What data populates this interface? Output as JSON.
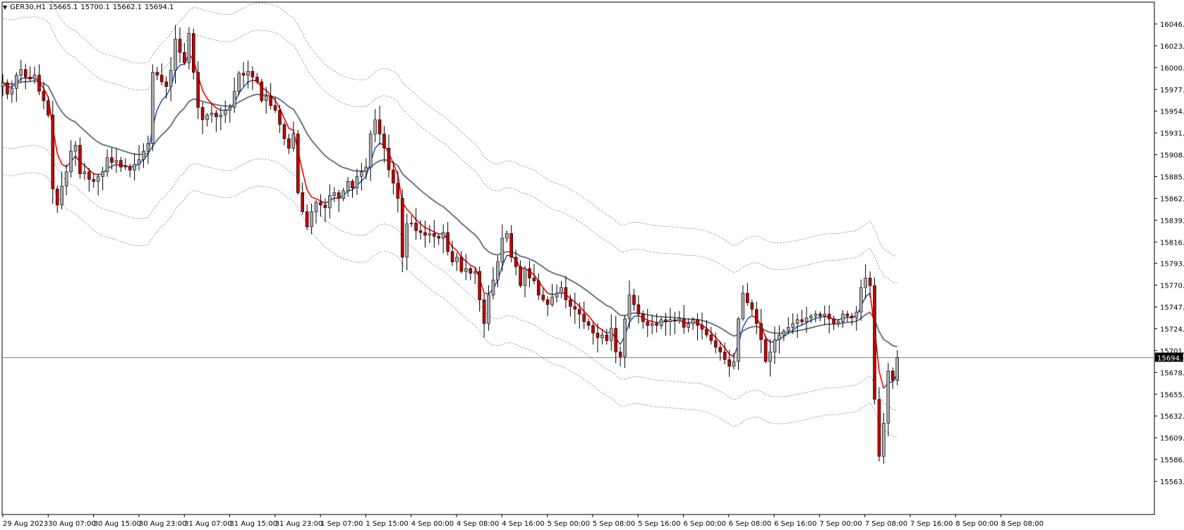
{
  "header": {
    "symbol": "GER30,H1",
    "open": "15665.1",
    "high": "15700.1",
    "low": "15662.1",
    "close": "15694.1"
  },
  "colors": {
    "bull_body": "#a9a9a9",
    "bear_body": "#c00000",
    "wick": "#000000",
    "ma_fast_down": "#ff0000",
    "ma_fast_up": "#2e5bb8",
    "ma_slow": "#6b7a8a",
    "envelope": "#808080",
    "price_line": "#808080"
  },
  "chart_data": {
    "type": "candlestick",
    "ylim": [
      15563.5,
      16060
    ],
    "y_ticks": [
      "16046.0",
      "16023.0",
      "16000.0",
      "15977.0",
      "15954.0",
      "15931.0",
      "15908.0",
      "15885.0",
      "15862.0",
      "15839.0",
      "15816.0",
      "15793.5",
      "15770.5",
      "15747.5",
      "15724.5",
      "15701.5",
      "15678.5",
      "15655.5",
      "15632.5",
      "15609.5",
      "15586.5",
      "15563.5"
    ],
    "current_price": "15694.1",
    "x_labels": [
      "29 Aug 2023",
      "30 Aug 07:00",
      "30 Aug 15:00",
      "30 Aug 23:00",
      "31 Aug 07:00",
      "31 Aug 15:00",
      "31 Aug 23:00",
      "1 Sep 07:00",
      "1 Sep 15:00",
      "4 Sep 00:00",
      "4 Sep 08:00",
      "4 Sep 16:00",
      "5 Sep 00:00",
      "5 Sep 08:00",
      "5 Sep 16:00",
      "6 Sep 00:00",
      "6 Sep 08:00",
      "6 Sep 16:00",
      "7 Sep 00:00",
      "7 Sep 08:00",
      "7 Sep 16:00",
      "8 Sep 00:00",
      "8 Sep 08:00"
    ],
    "closes": [
      15984,
      15972,
      15978,
      15992,
      15998,
      15990,
      15988,
      15992,
      15975,
      15965,
      15950,
      15872,
      15855,
      15875,
      15890,
      15912,
      15918,
      15888,
      15890,
      15882,
      15880,
      15885,
      15890,
      15905,
      15900,
      15902,
      15895,
      15896,
      15892,
      15898,
      15903,
      15912,
      15920,
      15995,
      15992,
      15985,
      15980,
      15997,
      16030,
      16016,
      16005,
      16036,
      15995,
      15958,
      15945,
      15950,
      15952,
      15948,
      15950,
      15955,
      15958,
      15975,
      15994,
      15992,
      15996,
      15990,
      15985,
      15965,
      15970,
      15960,
      15955,
      15940,
      15925,
      15915,
      15930,
      15868,
      15848,
      15832,
      15848,
      15858,
      15855,
      15852,
      15865,
      15868,
      15862,
      15870,
      15880,
      15873,
      15885,
      15890,
      15895,
      15930,
      15945,
      15930,
      15915,
      15892,
      15878,
      15862,
      15800,
      15835,
      15836,
      15828,
      15826,
      15823,
      15825,
      15822,
      15820,
      15826,
      15806,
      15795,
      15800,
      15785,
      15788,
      15783,
      15785,
      15755,
      15730,
      15760,
      15776,
      15795,
      15820,
      15825,
      15800,
      15790,
      15770,
      15788,
      15778,
      15775,
      15760,
      15755,
      15750,
      15758,
      15762,
      15768,
      15755,
      15748,
      15745,
      15740,
      15732,
      15728,
      15720,
      15715,
      15718,
      15712,
      15725,
      15700,
      15695,
      15735,
      15760,
      15750,
      15740,
      15732,
      15728,
      15730,
      15728,
      15734,
      15732,
      15734,
      15733,
      15735,
      15726,
      15730,
      15734,
      15728,
      15724,
      15718,
      15712,
      15705,
      15700,
      15692,
      15685,
      15690,
      15735,
      15762,
      15752,
      15745,
      15730,
      15713,
      15690,
      15700,
      15713,
      15718,
      15722,
      15726,
      15730,
      15734,
      15732,
      15736,
      15738,
      15740,
      15738,
      15740,
      15735,
      15730,
      15732,
      15740,
      15738,
      15736,
      15742,
      15768,
      15778,
      15770,
      15650,
      15590,
      15625,
      15680,
      15670,
      15694
    ],
    "series": [
      {
        "name": "",
        "kind": "ema-fast"
      },
      {
        "name": "",
        "kind": "ema-slow"
      },
      {
        "name": "",
        "kind": "envelope"
      }
    ]
  }
}
